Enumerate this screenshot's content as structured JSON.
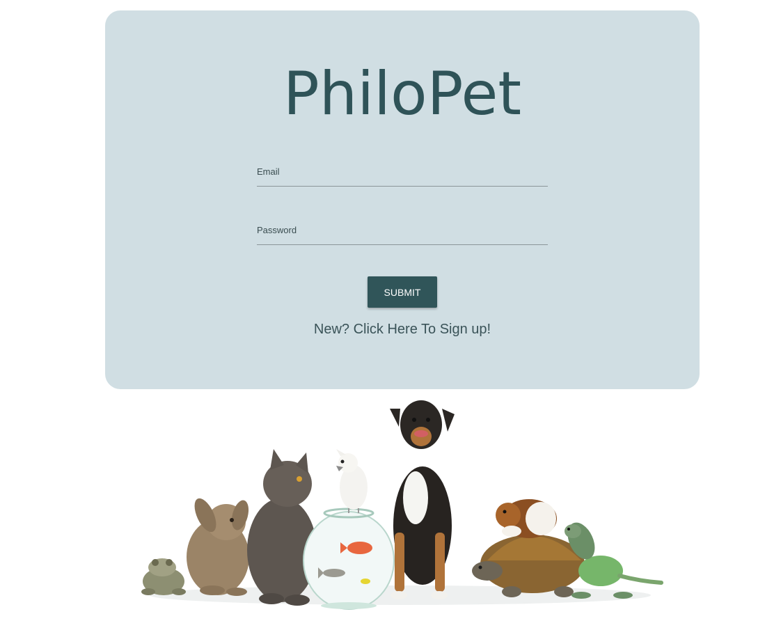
{
  "brand": {
    "title": "PhiloPet"
  },
  "form": {
    "email_label": "Email",
    "password_label": "Password",
    "submit_label": "SUBMIT",
    "signup_link": "New? Click Here To Sign up!"
  },
  "colors": {
    "card_background": "#d0dee3",
    "brand_text": "#2f5358",
    "button": "#305559"
  },
  "illustration": {
    "icons": [
      "frog-icon",
      "rabbit-icon",
      "cat-icon",
      "fishbowl-icon",
      "cockatoo-icon",
      "dog-icon",
      "guinea-pig-icon",
      "tortoise-icon",
      "iguana-icon"
    ]
  }
}
